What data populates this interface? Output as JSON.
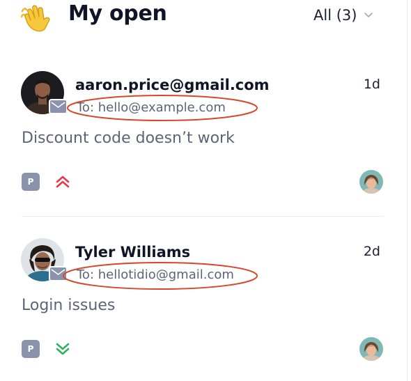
{
  "header": {
    "title": "My open",
    "filter_label": "All (3)"
  },
  "conversations": [
    {
      "sender": "aaron.price@gmail.com",
      "to": "To: hello@example.com",
      "time": "1d",
      "subject": "Discount code doesn’t work",
      "tag": "P",
      "priority": "high"
    },
    {
      "sender": "Tyler Williams",
      "to": "To: hellotidio@gmail.com",
      "time": "2d",
      "subject": "Login issues",
      "tag": "P",
      "priority": "low"
    }
  ],
  "colors": {
    "annotation_oval": "#d9472b",
    "priority_high": "#e5384f",
    "priority_low": "#2fb35b",
    "tag_bg": "#8a93ab",
    "mail_icon": "#8a93ab"
  }
}
